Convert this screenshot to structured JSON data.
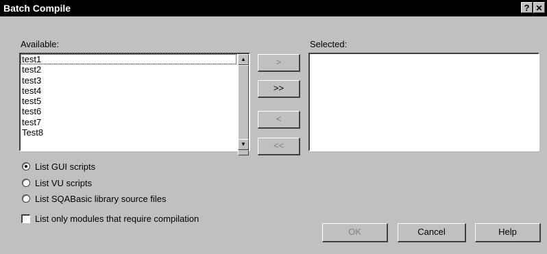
{
  "window": {
    "title": "Batch Compile",
    "help_button": "?",
    "close_button": "✕"
  },
  "available": {
    "label": "Available:",
    "items": [
      "test1",
      "test2",
      "test3",
      "test4",
      "test5",
      "test6",
      "test7",
      "Test8"
    ]
  },
  "selected": {
    "label": "Selected:",
    "items": []
  },
  "move_buttons": {
    "add": ">",
    "add_all": ">>",
    "remove": "<",
    "remove_all": "<<"
  },
  "script_type": {
    "options": [
      "List GUI scripts",
      "List VU scripts",
      "List SQABasic library source files"
    ],
    "selected": "List GUI scripts"
  },
  "only_modules": {
    "label": "List only modules that require compilation",
    "checked": false
  },
  "buttons": {
    "ok": "OK",
    "cancel": "Cancel",
    "help": "Help"
  }
}
